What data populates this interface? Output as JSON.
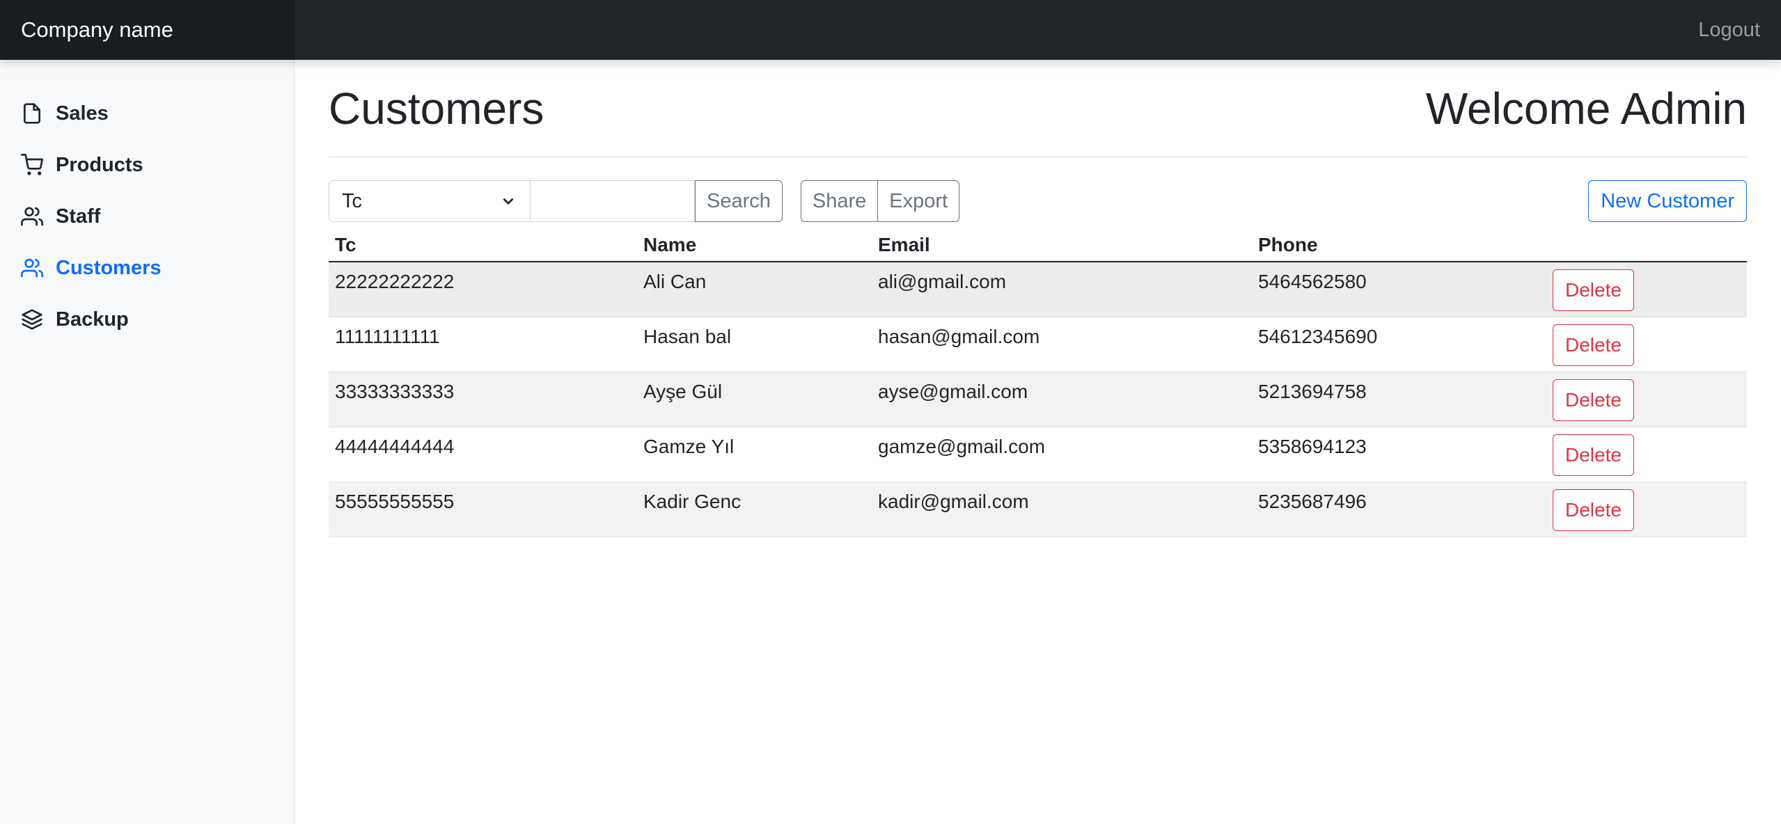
{
  "app": {
    "brand": "Company name",
    "logout_label": "Logout"
  },
  "sidebar": {
    "items": [
      {
        "label": "Sales",
        "icon": "file-icon",
        "active": false
      },
      {
        "label": "Products",
        "icon": "cart-icon",
        "active": false
      },
      {
        "label": "Staff",
        "icon": "users-icon",
        "active": false
      },
      {
        "label": "Customers",
        "icon": "users-icon",
        "active": true
      },
      {
        "label": "Backup",
        "icon": "layers-icon",
        "active": false
      }
    ]
  },
  "main": {
    "title": "Customers",
    "welcome": "Welcome Admin",
    "filter": {
      "selected": "Tc",
      "search_value": "",
      "search_label": "Search"
    },
    "share_label": "Share",
    "export_label": "Export",
    "new_customer_label": "New Customer",
    "columns": [
      "Tc",
      "Name",
      "Email",
      "Phone"
    ],
    "rows": [
      {
        "tc": "22222222222",
        "name": "Ali Can",
        "email": "ali@gmail.com",
        "phone": "5464562580",
        "action": "Delete"
      },
      {
        "tc": "11111111111",
        "name": "Hasan bal",
        "email": "hasan@gmail.com",
        "phone": "54612345690",
        "action": "Delete"
      },
      {
        "tc": "33333333333",
        "name": "Ayşe Gül",
        "email": "ayse@gmail.com",
        "phone": "5213694758",
        "action": "Delete"
      },
      {
        "tc": "44444444444",
        "name": "Gamze Yıl",
        "email": "gamze@gmail.com",
        "phone": "5358694123",
        "action": "Delete"
      },
      {
        "tc": "55555555555",
        "name": "Kadir Genc",
        "email": "kadir@gmail.com",
        "phone": "5235687496",
        "action": "Delete"
      }
    ]
  },
  "colors": {
    "topbar": "#212529",
    "accent": "#0d6efd",
    "danger": "#dc3545",
    "sidebar_bg": "#f8f9fa"
  }
}
